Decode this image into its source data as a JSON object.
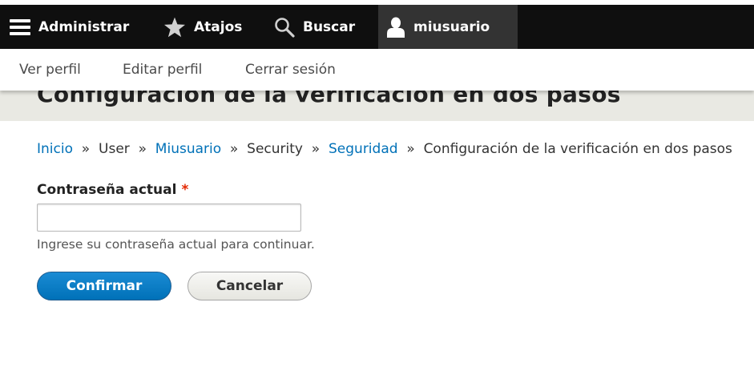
{
  "toolbar": {
    "items": [
      {
        "label": "Administrar",
        "icon": "hamburger-menu-icon"
      },
      {
        "label": "Atajos",
        "icon": "star-icon"
      },
      {
        "label": "Buscar",
        "icon": "search-icon"
      },
      {
        "label": "miusuario",
        "icon": "user-icon",
        "active": true
      }
    ],
    "colors": {
      "background": "#0f0f0f",
      "active_background": "#333333",
      "text": "#ffffff"
    }
  },
  "tray": {
    "links": [
      "Ver perfil",
      "Editar perfil",
      "Cerrar sesión"
    ]
  },
  "page": {
    "title": "Configuración de la verificación en dos pasos"
  },
  "breadcrumb": {
    "items": [
      {
        "label": "Inicio",
        "link": true
      },
      {
        "label": "User",
        "link": false
      },
      {
        "label": "Miusuario",
        "link": true
      },
      {
        "label": "Security",
        "link": false
      },
      {
        "label": "Seguridad",
        "link": true
      },
      {
        "label": "Configuración de la verificación en dos pasos",
        "link": false
      }
    ],
    "separator": "»",
    "link_color": "#0071b8"
  },
  "form": {
    "password_label": "Contraseña actual",
    "required_marker": "*",
    "password_value": "",
    "password_help": "Ingrese su contraseña actual para continuar.",
    "confirm_label": "Confirmar",
    "cancel_label": "Cancelar",
    "accent_color": "#0071b8"
  }
}
